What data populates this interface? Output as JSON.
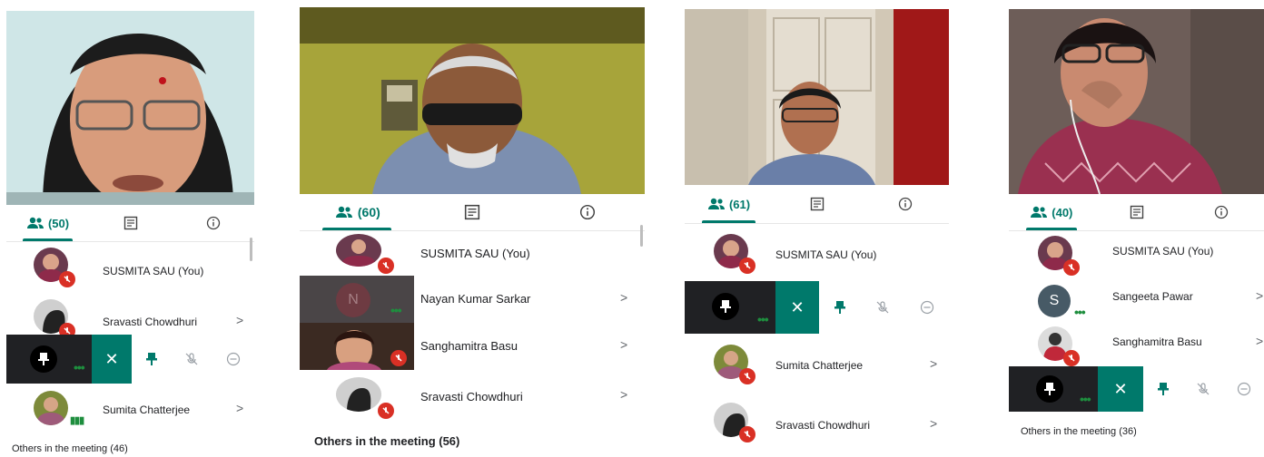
{
  "panels": [
    {
      "people_count": "(50)",
      "rows": [
        {
          "name": "SUSMITA SAU (You)",
          "chevron": ""
        },
        {
          "name": "Sravasti Chowdhuri",
          "chevron": ">"
        },
        {
          "name": "Sumita Chatterjee",
          "chevron": ">"
        }
      ],
      "others": "Others in the meeting (46)"
    },
    {
      "people_count": "(60)",
      "rows": [
        {
          "name": "SUSMITA SAU (You)",
          "chevron": ""
        },
        {
          "name": "Nayan Kumar Sarkar",
          "chevron": ">",
          "initial": "N"
        },
        {
          "name": "Sanghamitra Basu",
          "chevron": ">"
        },
        {
          "name": "Sravasti Chowdhuri",
          "chevron": ">"
        }
      ],
      "others": "Others in the meeting (56)"
    },
    {
      "people_count": "(61)",
      "rows": [
        {
          "name": "SUSMITA SAU (You)",
          "chevron": ""
        },
        {
          "name": "Sumita Chatterjee",
          "chevron": ">"
        },
        {
          "name": "Sravasti Chowdhuri",
          "chevron": ">"
        }
      ]
    },
    {
      "people_count": "(40)",
      "rows": [
        {
          "name": "SUSMITA SAU (You)",
          "chevron": ""
        },
        {
          "name": "Sangeeta Pawar",
          "chevron": ">",
          "initial": "S"
        },
        {
          "name": "Sanghamitra Basu",
          "chevron": ">"
        }
      ],
      "others": "Others in the meeting (36)"
    }
  ],
  "colors": {
    "accent": "#00796b",
    "mute": "#d93025",
    "dark": "#202124"
  },
  "icons": {
    "close": "✕",
    "people": "people-icon",
    "chat": "chat-icon",
    "info": "info-icon",
    "pin": "pin-icon",
    "mic_off": "mic-off-icon",
    "remove": "remove-icon"
  }
}
